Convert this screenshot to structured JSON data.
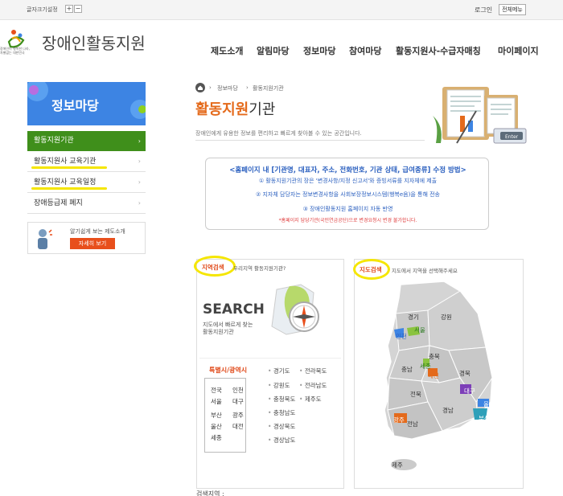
{
  "topbar": {
    "font_size_label": "글자크기설정",
    "font_plus": "+",
    "font_minus": "−",
    "login": "로그인",
    "all_menu": "전체메뉴"
  },
  "logo": {
    "title": "장애인활동지원",
    "slogan_line1": "장애인이 행복한 나라,",
    "slogan_line2": "차별없는 대한민국"
  },
  "gnb": [
    "제도소개",
    "알림마당",
    "정보마당",
    "참여마당",
    "활동지원사-수급자매칭",
    "마이페이지"
  ],
  "sidebar": {
    "banner_title": "정보마당",
    "items": [
      {
        "label": "활동지원기관"
      },
      {
        "label": "활동지원사 교육기관"
      },
      {
        "label": "활동지원사 교육일정"
      },
      {
        "label": "장애등급제 폐지"
      }
    ],
    "intro": {
      "text": "알기쉽게 보는 제도소개",
      "button": "자세히 보기"
    }
  },
  "breadcrumb": [
    "정보마당",
    "활동지원기관"
  ],
  "page": {
    "title_highlight": "활동지원",
    "title_rest": "기관",
    "description": "장애인에게 유용한 정보를 편리하고 빠르게 찾아볼 수 있는 공간입니다."
  },
  "notice": {
    "heading": "<홈페이지 내 [기관명, 대표자, 주소, 전화번호, 기관 상태, 급여종류] 수정 방법>",
    "line1": "① 활동지원기관의 장은 '변경사항/지정 신고서'와 증빙서류를 지자체에 제출",
    "line2": "② 지자체 담당자는 정보변경사항을 사회보장정보시스템(행복e음)을 통해 전송",
    "line3": "③ 장애인활동지원 홈페이지 자동 반영",
    "footnote": "*홈페이지 담당기관(국민연금공단)으로 변경요청시 변경 불가합니다."
  },
  "region_search": {
    "title": "지역검색",
    "subtitle": "우리지역 활동지원기관?",
    "search_word": "SEARCH",
    "desc_line1": "지도에서 빠르게 찾는",
    "desc_line2": "활동지원기관",
    "metro_label": "특별시/광역시",
    "metro_cities": [
      "전국",
      "인천",
      "서울",
      "대구",
      "부산",
      "광주",
      "울산",
      "대전",
      "세종"
    ],
    "provinces_col1": [
      "경기도",
      "강원도",
      "충청북도",
      "충청남도",
      "경상북도",
      "경상남도"
    ],
    "provinces_col2": [
      "전라북도",
      "전라남도",
      "제주도"
    ]
  },
  "map_search": {
    "title": "지도검색",
    "subtitle": "지도에서 지역을 선택해주세요",
    "regions": [
      "경기",
      "강원",
      "서울",
      "인천",
      "충북",
      "충남",
      "세종",
      "대전",
      "경북",
      "전북",
      "대구",
      "울산",
      "경남",
      "부산",
      "광주",
      "전남",
      "제주"
    ]
  },
  "bottom_label": "검색지역 :",
  "colors": {
    "accent_orange": "#e46a1b",
    "side_green": "#3f8f1b",
    "banner_blue": "#3d84e3",
    "notice_blue": "#2a5fbf",
    "highlight_yellow": "#f5e600"
  }
}
